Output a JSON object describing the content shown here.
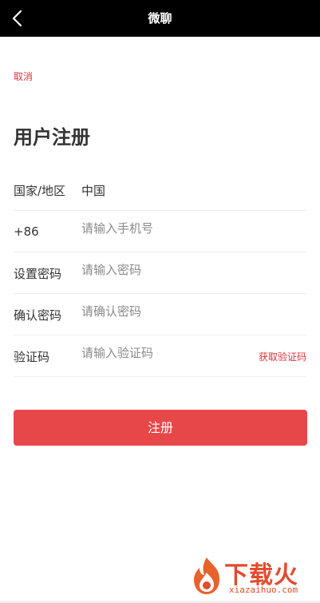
{
  "header": {
    "title": "微聊",
    "back_icon": "chevron-left-icon"
  },
  "cancel_label": "取消",
  "page_heading": "用户注册",
  "form": {
    "country": {
      "label": "国家/地区",
      "value": "中国"
    },
    "phone": {
      "prefix": "+86",
      "placeholder": "请输入手机号"
    },
    "password": {
      "label": "设置密码",
      "placeholder": "请输入密码"
    },
    "confirm": {
      "label": "确认密码",
      "placeholder": "请确认密码"
    },
    "code": {
      "label": "验证码",
      "placeholder": "请输入验证码",
      "action": "获取验证码"
    }
  },
  "register_label": "注册",
  "watermark": {
    "brand": "下载火",
    "url": "xiazaihuo.com"
  },
  "colors": {
    "accent": "#e2333a",
    "button": "#e8474a",
    "header_bg": "#000000"
  }
}
